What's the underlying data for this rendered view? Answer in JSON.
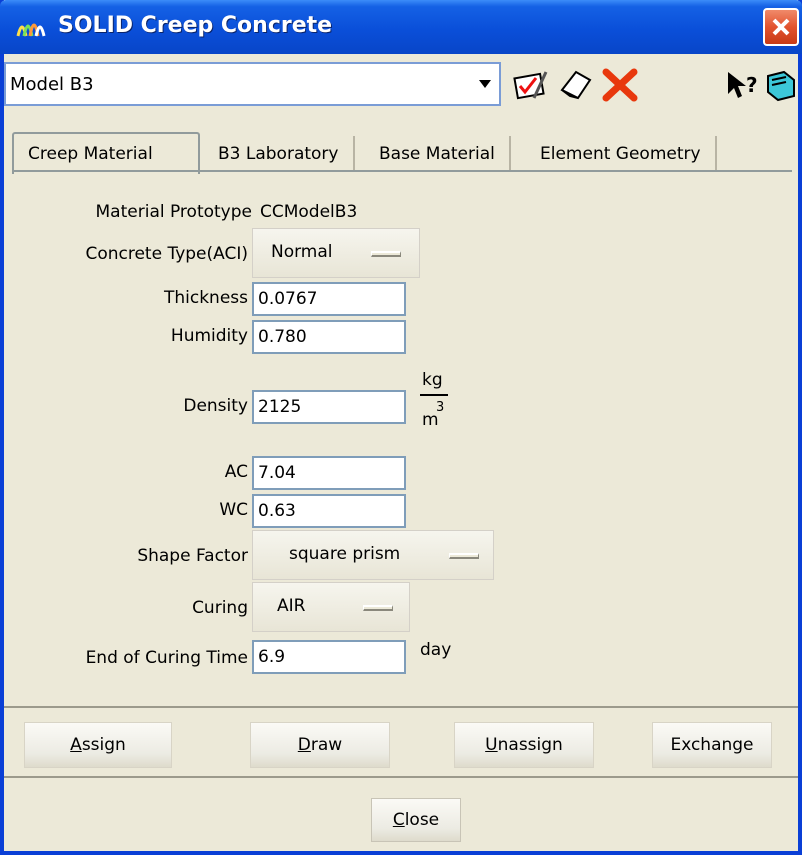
{
  "window": {
    "title": "SOLID Creep Concrete"
  },
  "toolbar": {
    "model_value": "Model B3"
  },
  "tabs": [
    {
      "label": "Creep Material"
    },
    {
      "label": "B3 Laboratory"
    },
    {
      "label": "Base Material"
    },
    {
      "label": "Element Geometry"
    }
  ],
  "form": {
    "prototype_label": "Material Prototype",
    "prototype_value": "CCModelB3",
    "concrete_type_label": "Concrete Type(ACI)",
    "concrete_type_value": "Normal",
    "thickness_label": "Thickness",
    "thickness_value": "0.0767",
    "humidity_label": "Humidity",
    "humidity_value": "0.780",
    "density_label": "Density",
    "density_value": "2125",
    "density_unit_num": "kg",
    "density_unit_den": "m",
    "density_unit_exp": "3",
    "ac_label": "AC",
    "ac_value": "7.04",
    "wc_label": "WC",
    "wc_value": "0.63",
    "shape_label": "Shape Factor",
    "shape_value": "square prism",
    "curing_label": "Curing",
    "curing_value": "AIR",
    "end_curing_label": "End of Curing Time",
    "end_curing_value": "6.9",
    "end_curing_unit": "day"
  },
  "actions": {
    "assign_rest": "ssign",
    "assign_mn": "A",
    "draw_mn": "D",
    "draw_rest": "raw",
    "unassign_mn": "U",
    "unassign_rest": "nassign",
    "exchange": "Exchange",
    "close_mn": "C",
    "close_rest": "lose"
  },
  "colors": {
    "title_blue": "#0a4fd9",
    "window_bg": "#ece9d8"
  }
}
